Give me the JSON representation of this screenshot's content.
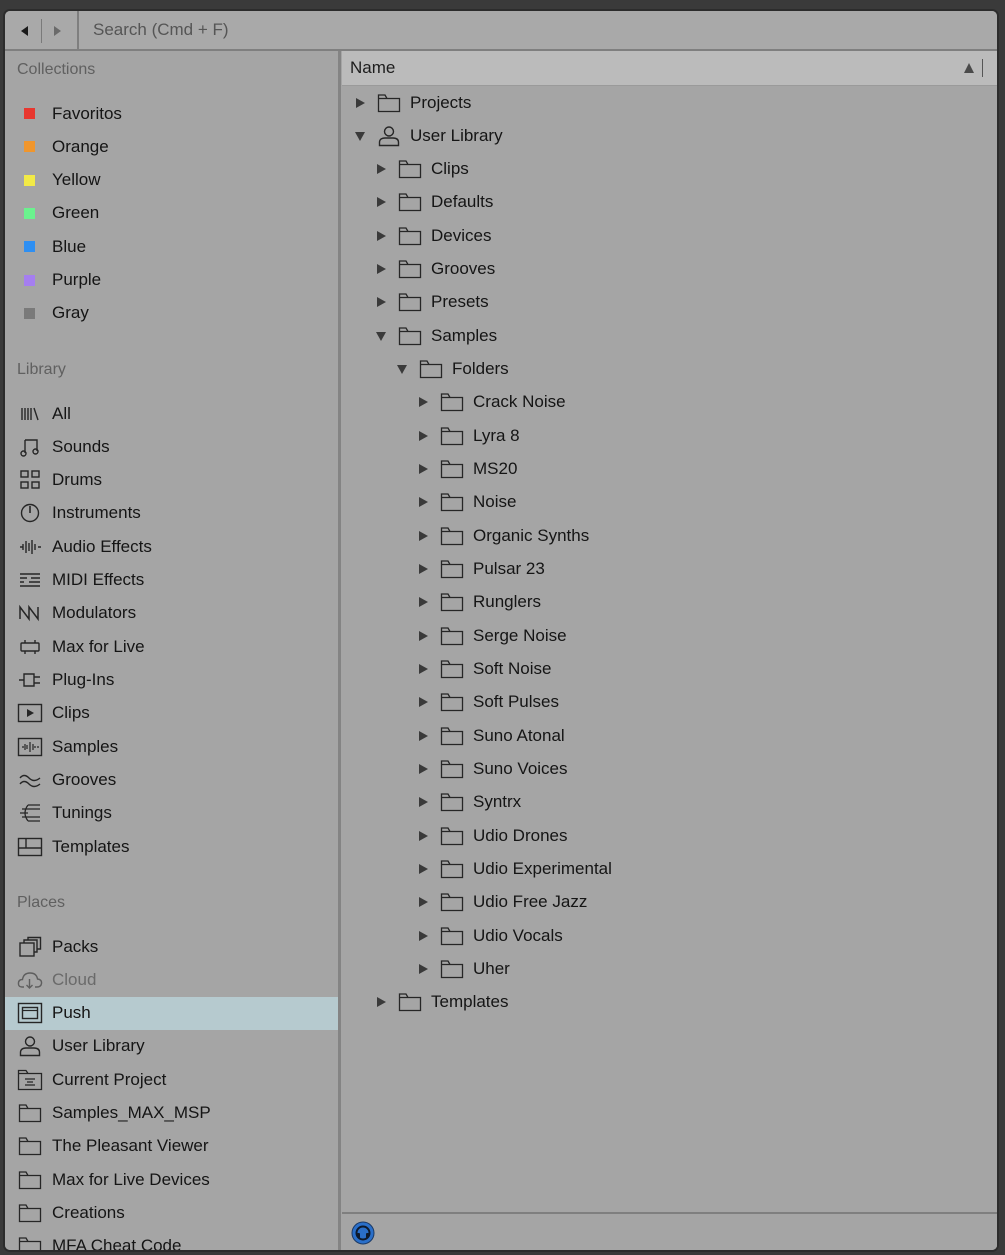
{
  "search": {
    "placeholder": "Search (Cmd + F)"
  },
  "colors": {
    "background": "#a5a5a5",
    "selection": "#b6cacf",
    "accent": "#2a6fc9"
  },
  "sidebar": {
    "collections": {
      "title": "Collections",
      "items": [
        {
          "label": "Favoritos",
          "color": "#e8372f"
        },
        {
          "label": "Orange",
          "color": "#f0962d"
        },
        {
          "label": "Yellow",
          "color": "#f2ea46"
        },
        {
          "label": "Green",
          "color": "#6bf28e"
        },
        {
          "label": "Blue",
          "color": "#2e8ff2"
        },
        {
          "label": "Purple",
          "color": "#a57ef0"
        },
        {
          "label": "Gray",
          "color": "#7a7a7a"
        }
      ]
    },
    "library": {
      "title": "Library",
      "items": [
        {
          "label": "All",
          "icon": "all-icon"
        },
        {
          "label": "Sounds",
          "icon": "sounds-icon"
        },
        {
          "label": "Drums",
          "icon": "drums-icon"
        },
        {
          "label": "Instruments",
          "icon": "instruments-icon"
        },
        {
          "label": "Audio Effects",
          "icon": "audio-effects-icon"
        },
        {
          "label": "MIDI Effects",
          "icon": "midi-effects-icon"
        },
        {
          "label": "Modulators",
          "icon": "modulators-icon"
        },
        {
          "label": "Max for Live",
          "icon": "max-for-live-icon"
        },
        {
          "label": "Plug-Ins",
          "icon": "plug-ins-icon"
        },
        {
          "label": "Clips",
          "icon": "clips-icon"
        },
        {
          "label": "Samples",
          "icon": "samples-icon"
        },
        {
          "label": "Grooves",
          "icon": "grooves-icon"
        },
        {
          "label": "Tunings",
          "icon": "tunings-icon"
        },
        {
          "label": "Templates",
          "icon": "templates-icon"
        }
      ]
    },
    "places": {
      "title": "Places",
      "items": [
        {
          "label": "Packs",
          "icon": "packs-icon"
        },
        {
          "label": "Cloud",
          "icon": "cloud-icon"
        },
        {
          "label": "Push",
          "icon": "push-icon"
        },
        {
          "label": "User Library",
          "icon": "user-icon"
        },
        {
          "label": "Current Project",
          "icon": "project-icon"
        },
        {
          "label": "Samples_MAX_MSP",
          "icon": "folder-icon"
        },
        {
          "label": "The Pleasant Viewer",
          "icon": "folder-icon"
        },
        {
          "label": "Max for Live Devices",
          "icon": "folder-icon"
        },
        {
          "label": "Creations",
          "icon": "folder-icon"
        },
        {
          "label": "MFA Cheat Code",
          "icon": "folder-icon"
        }
      ]
    }
  },
  "main": {
    "column_header": "Name",
    "tree": [
      {
        "label": "Projects",
        "level": 0,
        "expanded": false,
        "icon": "folder-icon"
      },
      {
        "label": "User Library",
        "level": 0,
        "expanded": true,
        "icon": "user-icon"
      },
      {
        "label": "Clips",
        "level": 1,
        "expanded": false,
        "icon": "folder-icon"
      },
      {
        "label": "Defaults",
        "level": 1,
        "expanded": false,
        "icon": "folder-icon"
      },
      {
        "label": "Devices",
        "level": 1,
        "expanded": false,
        "icon": "folder-icon"
      },
      {
        "label": "Grooves",
        "level": 1,
        "expanded": false,
        "icon": "folder-icon"
      },
      {
        "label": "Presets",
        "level": 1,
        "expanded": false,
        "icon": "folder-icon"
      },
      {
        "label": "Samples",
        "level": 1,
        "expanded": true,
        "icon": "folder-icon"
      },
      {
        "label": "Folders",
        "level": 2,
        "expanded": true,
        "icon": "folder-icon"
      },
      {
        "label": "Crack Noise",
        "level": 3,
        "expanded": false,
        "icon": "folder-icon"
      },
      {
        "label": "Lyra 8",
        "level": 3,
        "expanded": false,
        "icon": "folder-icon"
      },
      {
        "label": "MS20",
        "level": 3,
        "expanded": false,
        "icon": "folder-icon"
      },
      {
        "label": "Noise",
        "level": 3,
        "expanded": false,
        "icon": "folder-icon"
      },
      {
        "label": "Organic Synths",
        "level": 3,
        "expanded": false,
        "icon": "folder-icon"
      },
      {
        "label": "Pulsar 23",
        "level": 3,
        "expanded": false,
        "icon": "folder-icon"
      },
      {
        "label": "Runglers",
        "level": 3,
        "expanded": false,
        "icon": "folder-icon"
      },
      {
        "label": "Serge Noise",
        "level": 3,
        "expanded": false,
        "icon": "folder-icon"
      },
      {
        "label": "Soft Noise",
        "level": 3,
        "expanded": false,
        "icon": "folder-icon"
      },
      {
        "label": "Soft Pulses",
        "level": 3,
        "expanded": false,
        "icon": "folder-icon"
      },
      {
        "label": "Suno Atonal",
        "level": 3,
        "expanded": false,
        "icon": "folder-icon"
      },
      {
        "label": "Suno Voices",
        "level": 3,
        "expanded": false,
        "icon": "folder-icon"
      },
      {
        "label": "Syntrx",
        "level": 3,
        "expanded": false,
        "icon": "folder-icon"
      },
      {
        "label": "Udio Drones",
        "level": 3,
        "expanded": false,
        "icon": "folder-icon"
      },
      {
        "label": "Udio Experimental",
        "level": 3,
        "expanded": false,
        "icon": "folder-icon"
      },
      {
        "label": "Udio Free Jazz",
        "level": 3,
        "expanded": false,
        "icon": "folder-icon"
      },
      {
        "label": "Udio Vocals",
        "level": 3,
        "expanded": false,
        "icon": "folder-icon"
      },
      {
        "label": "Uher",
        "level": 3,
        "expanded": false,
        "icon": "folder-icon"
      },
      {
        "label": "Templates",
        "level": 1,
        "expanded": false,
        "icon": "folder-icon"
      }
    ]
  }
}
